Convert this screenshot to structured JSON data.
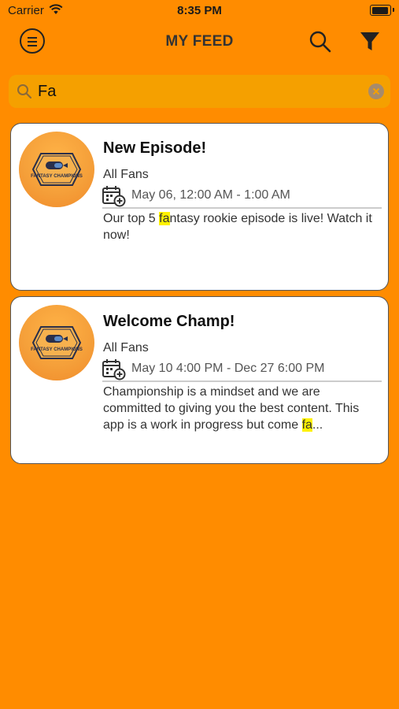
{
  "status_bar": {
    "carrier": "Carrier",
    "time": "8:35 PM"
  },
  "nav": {
    "title": "MY FEED"
  },
  "search": {
    "value": "Fa"
  },
  "feed": [
    {
      "title": "New Episode!",
      "audience": "All Fans",
      "date_range": "May 06, 12:00 AM - 1:00 AM",
      "desc_before": "Our top 5 ",
      "desc_highlight": "fa",
      "desc_after": "ntasy rookie episode is live! Watch it now!"
    },
    {
      "title": "Welcome Champ!",
      "audience": "All Fans",
      "date_range": "May 10 4:00 PM - Dec 27 6:00 PM",
      "desc_before": "Championship is a mindset and we are committed to giving you the best content. This app is a work in progress but come ",
      "desc_highlight": "fa",
      "desc_after": "..."
    }
  ],
  "logo_text": "FANTASY CHAMPIONS",
  "colors": {
    "background": "#FF8C00",
    "search_field": "#F5A000",
    "highlight": "#FFF200"
  }
}
